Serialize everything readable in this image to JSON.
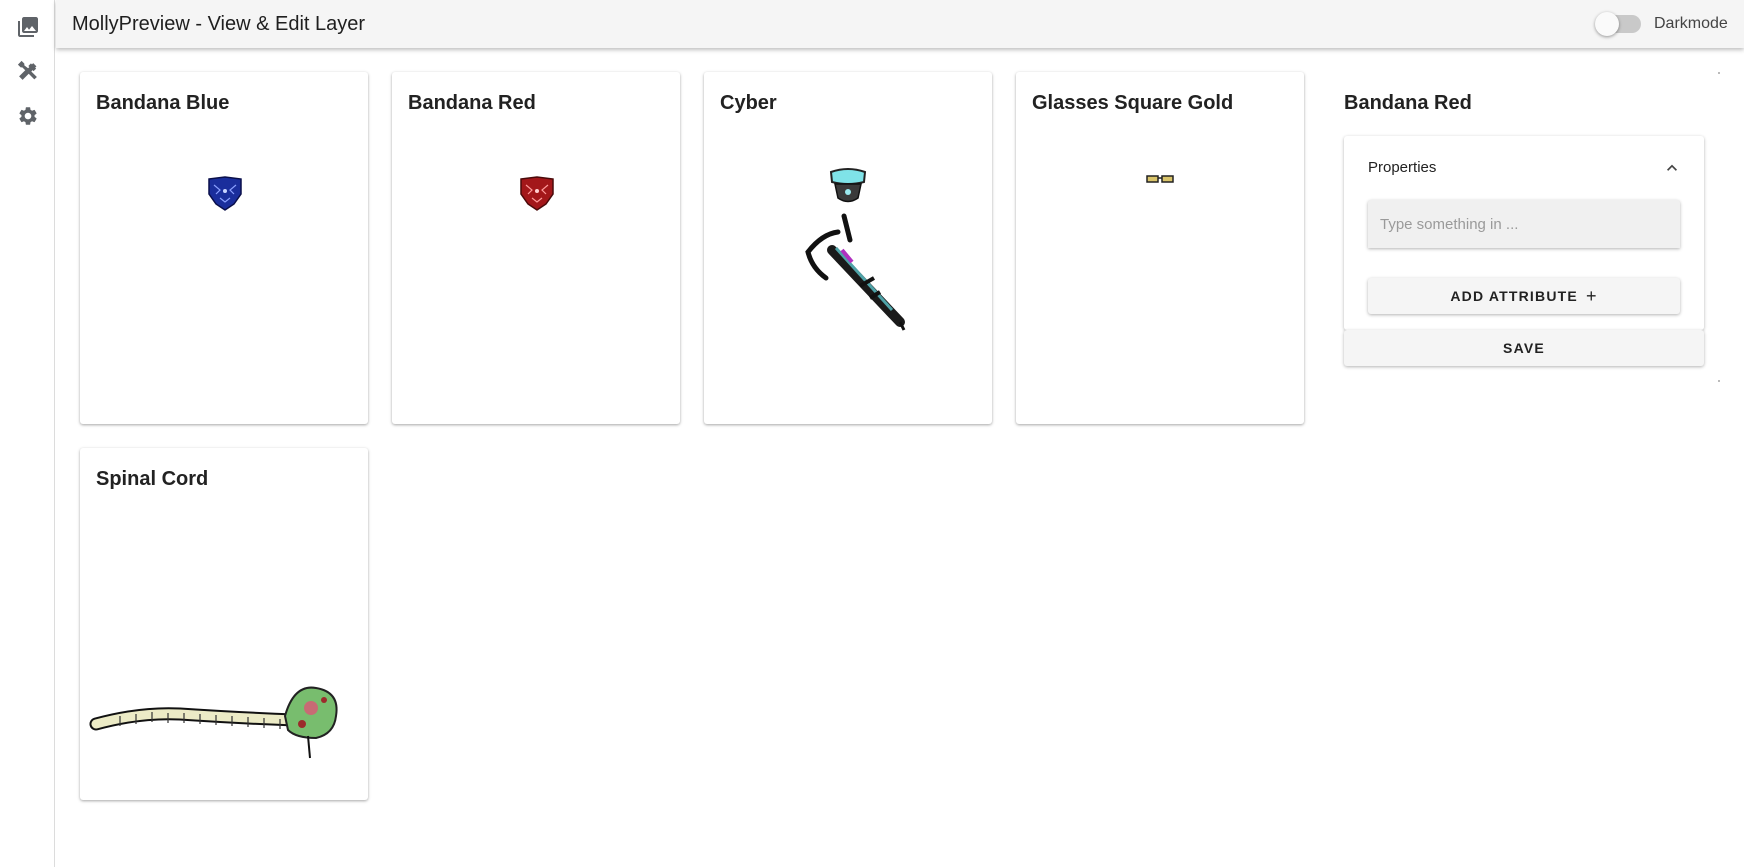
{
  "nav": {
    "items": [
      {
        "icon": "image-gallery-icon",
        "label": "Gallery"
      },
      {
        "icon": "tools-icon",
        "label": "Tools"
      },
      {
        "icon": "gear-icon",
        "label": "Settings"
      }
    ]
  },
  "appbar": {
    "title": "MollyPreview - View & Edit Layer",
    "darkmode_label": "Darkmode",
    "darkmode_on": false
  },
  "cards": [
    {
      "title": "Bandana Blue",
      "art": "bandana-blue"
    },
    {
      "title": "Bandana Red",
      "art": "bandana-red"
    },
    {
      "title": "Cyber",
      "art": "cyber"
    },
    {
      "title": "Glasses Square Gold",
      "art": "glasses-square-gold"
    },
    {
      "title": "Spinal Cord",
      "art": "spinal-cord"
    }
  ],
  "panel": {
    "title": "Bandana Red",
    "properties_label": "Properties",
    "input_placeholder": "Type something in ...",
    "input_value": "",
    "add_attribute_label": "Add Attribute",
    "add_icon": "plus-icon",
    "collapse_icon": "chevron-up-icon",
    "save_label": "Save"
  },
  "colors": {
    "appbar_bg": "#f5f5f5",
    "nav_icon": "#5f6368",
    "button_bg": "#f5f5f5",
    "input_bg": "#f0f0f0"
  }
}
